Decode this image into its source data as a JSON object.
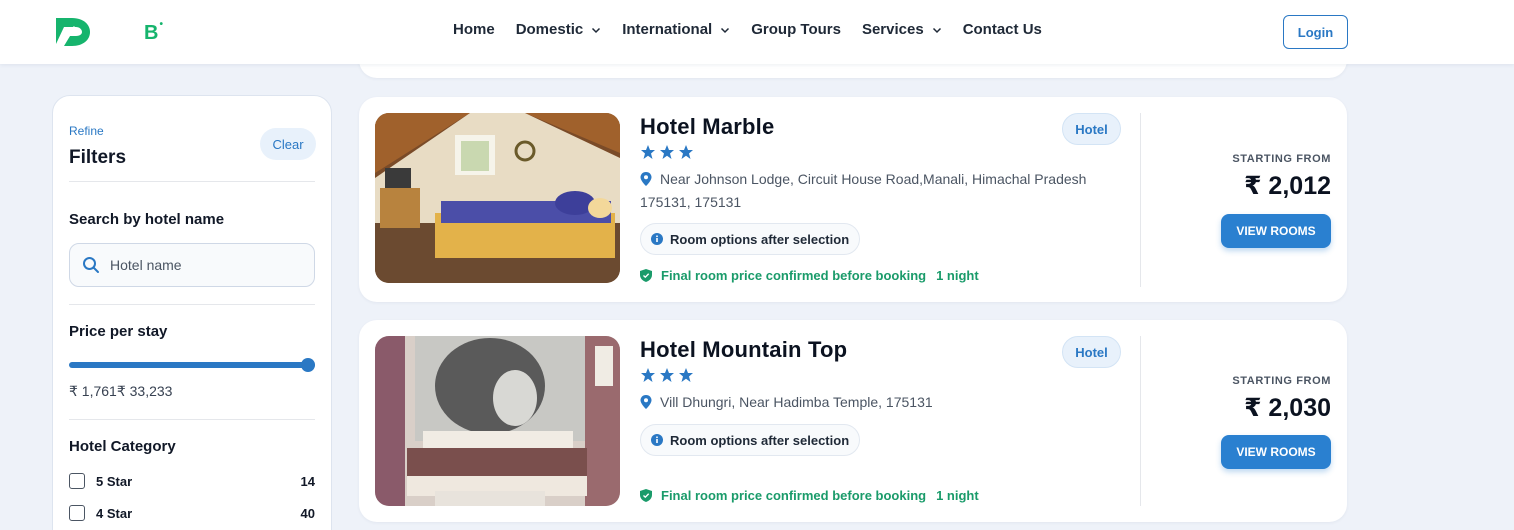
{
  "header": {
    "logo_letter": "B",
    "nav": [
      {
        "label": "Home",
        "has_dropdown": false
      },
      {
        "label": "Domestic",
        "has_dropdown": true
      },
      {
        "label": "International",
        "has_dropdown": true
      },
      {
        "label": "Group Tours",
        "has_dropdown": false
      },
      {
        "label": "Services",
        "has_dropdown": true
      },
      {
        "label": "Contact Us",
        "has_dropdown": false
      }
    ],
    "login_label": "Login"
  },
  "sidebar": {
    "refine_label": "Refine",
    "filters_title": "Filters",
    "clear_label": "Clear",
    "search_title": "Search by hotel name",
    "search_placeholder": "Hotel name",
    "price_title": "Price per stay",
    "price_range_text": "₹ 1,761₹ 33,233",
    "price_slider_fraction": 1.0,
    "category_title": "Hotel Category",
    "categories": [
      {
        "label": "5 Star",
        "count": "14",
        "checked": false
      },
      {
        "label": "4 Star",
        "count": "40",
        "checked": false
      }
    ]
  },
  "hotels": [
    {
      "name": "Hotel Marble",
      "stars": 3,
      "type": "Hotel",
      "address_line1": "Near Johnson Lodge, Circuit House Road,Manali, Himachal Pradesh",
      "address_line2": "175131, 175131",
      "room_options": "Room options after selection",
      "confirm_text": "Final room price confirmed before booking",
      "nights": "1 night",
      "starting_from": "STARTING FROM",
      "price": "₹ 2,012",
      "button": "VIEW ROOMS"
    },
    {
      "name": "Hotel Mountain Top",
      "stars": 3,
      "type": "Hotel",
      "address_line1": "Vill Dhungri, Near Hadimba Temple, 175131",
      "address_line2": "",
      "room_options": "Room options after selection",
      "confirm_text": "Final room price confirmed before booking",
      "nights": "1 night",
      "starting_from": "STARTING FROM",
      "price": "₹ 2,030",
      "button": "VIEW ROOMS"
    }
  ],
  "colors": {
    "accent": "#2a78c4",
    "brand_green": "#16b46d",
    "success_green": "#1a9b6a",
    "page_bg": "#eef2f9"
  }
}
